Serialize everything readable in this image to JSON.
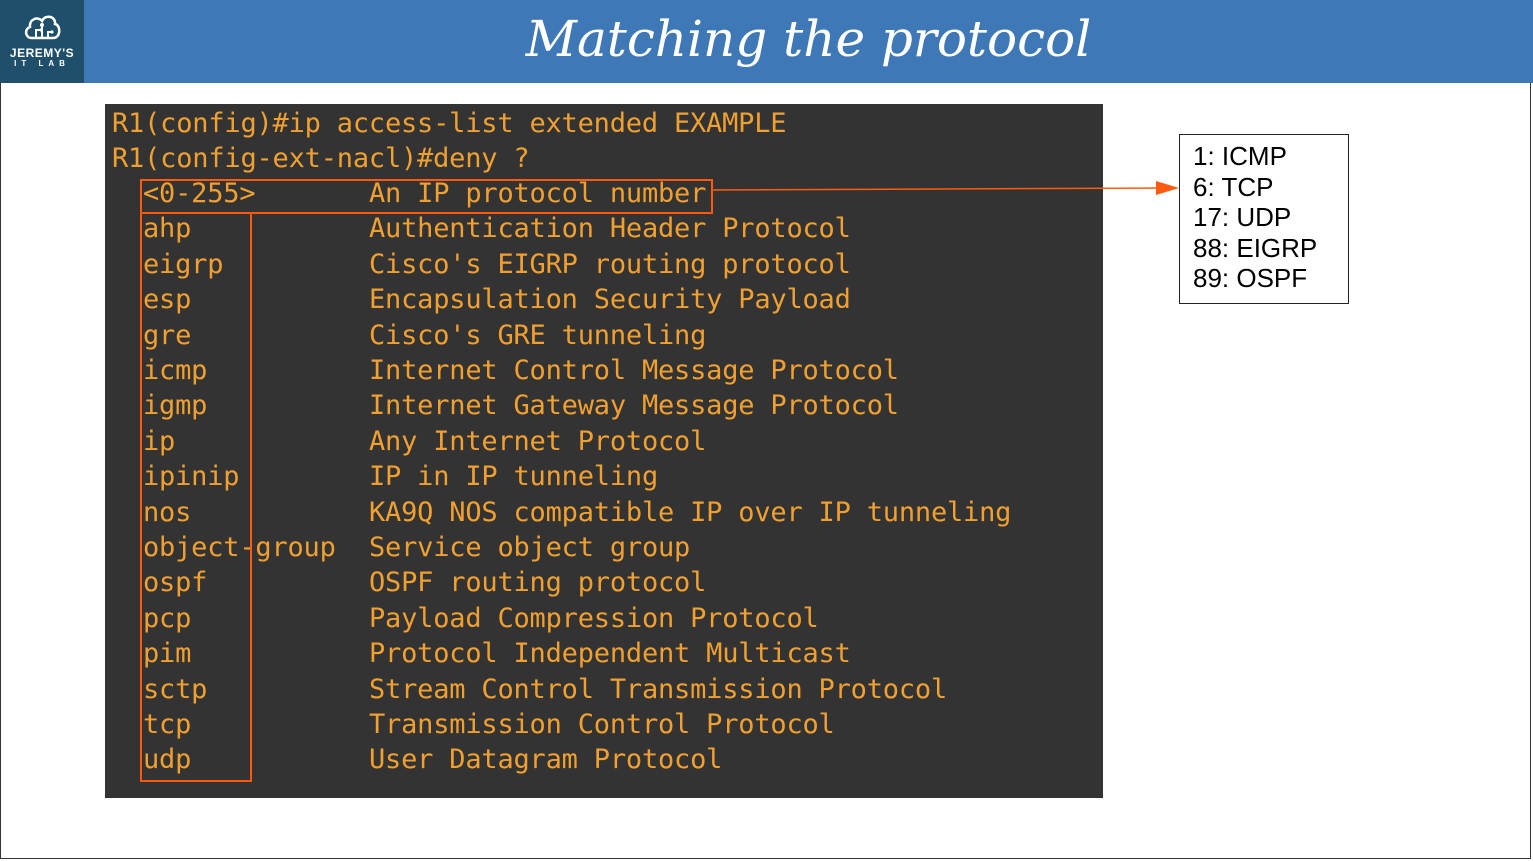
{
  "header": {
    "title": "Matching the protocol",
    "logo_line1": "JEREMY'S",
    "logo_line2": "IT LAB",
    "logo_icon": "cloud-circuit-icon",
    "bg_color": "#3f78b7",
    "logo_bg_color": "#1f4f6b"
  },
  "terminal": {
    "bg_color": "#333333",
    "text_color": "#f0a030",
    "highlight_color": "#ff5a10",
    "commands": [
      "R1(config)#ip access-list extended EXAMPLE",
      "R1(config-ext-nacl)#deny ?"
    ],
    "rows": [
      {
        "keyword": "<0-255>",
        "description": "An IP protocol number"
      },
      {
        "keyword": "ahp",
        "description": "Authentication Header Protocol"
      },
      {
        "keyword": "eigrp",
        "description": "Cisco's EIGRP routing protocol"
      },
      {
        "keyword": "esp",
        "description": "Encapsulation Security Payload"
      },
      {
        "keyword": "gre",
        "description": "Cisco's GRE tunneling"
      },
      {
        "keyword": "icmp",
        "description": "Internet Control Message Protocol"
      },
      {
        "keyword": "igmp",
        "description": "Internet Gateway Message Protocol"
      },
      {
        "keyword": "ip",
        "description": "Any Internet Protocol"
      },
      {
        "keyword": "ipinip",
        "description": "IP in IP tunneling"
      },
      {
        "keyword": "nos",
        "description": "KA9Q NOS compatible IP over IP tunneling"
      },
      {
        "keyword": "object-group",
        "description": "Service object group"
      },
      {
        "keyword": "ospf",
        "description": "OSPF routing protocol"
      },
      {
        "keyword": "pcp",
        "description": "Payload Compression Protocol"
      },
      {
        "keyword": "pim",
        "description": "Protocol Independent Multicast"
      },
      {
        "keyword": "sctp",
        "description": "Stream Control Transmission Protocol"
      },
      {
        "keyword": "tcp",
        "description": "Transmission Control Protocol"
      },
      {
        "keyword": "udp",
        "description": "User Datagram Protocol"
      }
    ]
  },
  "protocol_numbers": [
    "1: ICMP",
    "6: TCP",
    "17: UDP",
    "88: EIGRP",
    "89: OSPF"
  ]
}
